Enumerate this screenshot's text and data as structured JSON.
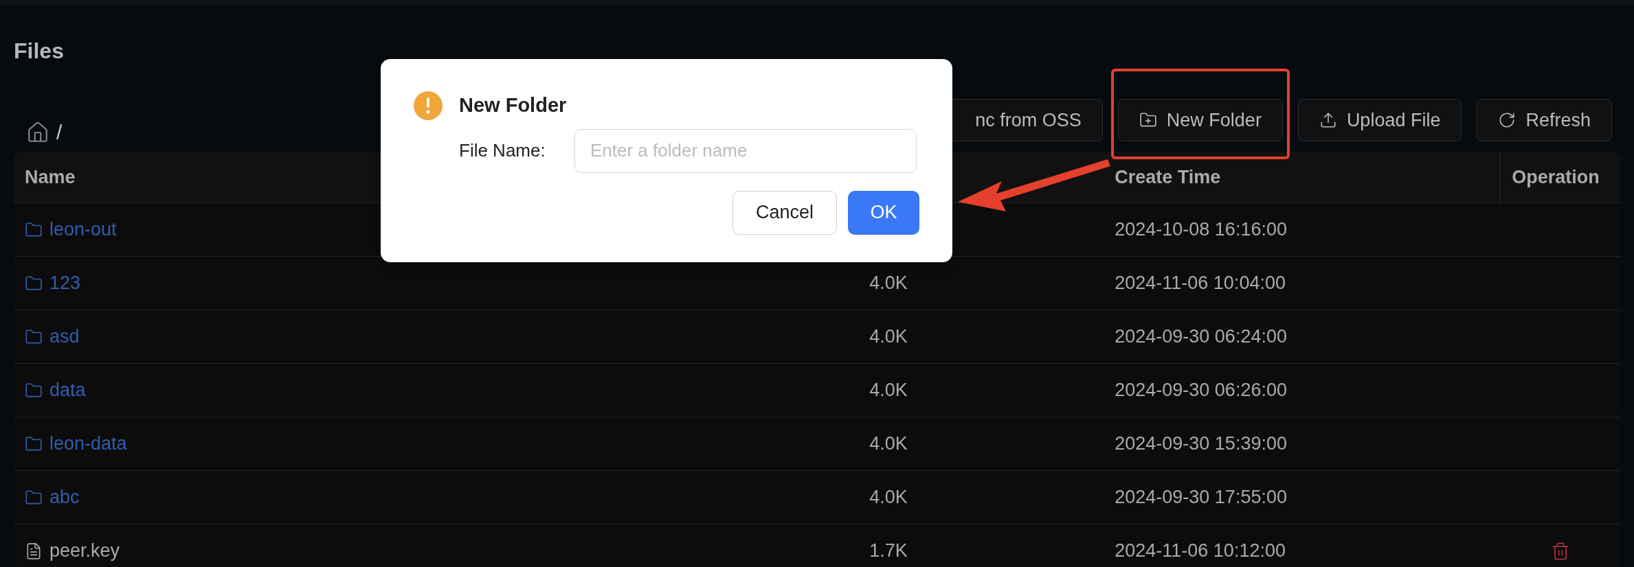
{
  "page": {
    "title": "Files"
  },
  "breadcrumb": {
    "path": "/"
  },
  "toolbar": [
    {
      "label": "nc from OSS",
      "kind": "sync"
    },
    {
      "label": "New Folder",
      "kind": "folder",
      "highlighted": true
    },
    {
      "label": "Upload File",
      "kind": "upload",
      "highlighted": false
    },
    {
      "label": "Refresh",
      "kind": "refresh",
      "highlighted": false
    }
  ],
  "table": {
    "columns": [
      "Name",
      "",
      "Create Time",
      "Operation"
    ],
    "rows": [
      {
        "kind": "folder",
        "name": "leon-out",
        "size": "",
        "create_time": "2024-10-08 16:16:00",
        "deletable": false
      },
      {
        "kind": "folder",
        "name": "123",
        "size": "4.0K",
        "create_time": "2024-11-06 10:04:00",
        "deletable": false
      },
      {
        "kind": "folder",
        "name": "asd",
        "size": "4.0K",
        "create_time": "2024-09-30 06:24:00",
        "deletable": false
      },
      {
        "kind": "folder",
        "name": "data",
        "size": "4.0K",
        "create_time": "2024-09-30 06:26:00",
        "deletable": false
      },
      {
        "kind": "folder",
        "name": "leon-data",
        "size": "4.0K",
        "create_time": "2024-09-30 15:39:00",
        "deletable": false
      },
      {
        "kind": "folder",
        "name": "abc",
        "size": "4.0K",
        "create_time": "2024-09-30 17:55:00",
        "deletable": false
      },
      {
        "kind": "file",
        "name": "peer.key",
        "size": "1.7K",
        "create_time": "2024-11-06 10:12:00",
        "deletable": true
      }
    ]
  },
  "dialog": {
    "title": "New Folder",
    "field_label": "File Name:",
    "placeholder": "Enter a folder name",
    "buttons": [
      {
        "label": "Cancel",
        "primary": false
      },
      {
        "label": "OK",
        "primary": true
      }
    ]
  }
}
